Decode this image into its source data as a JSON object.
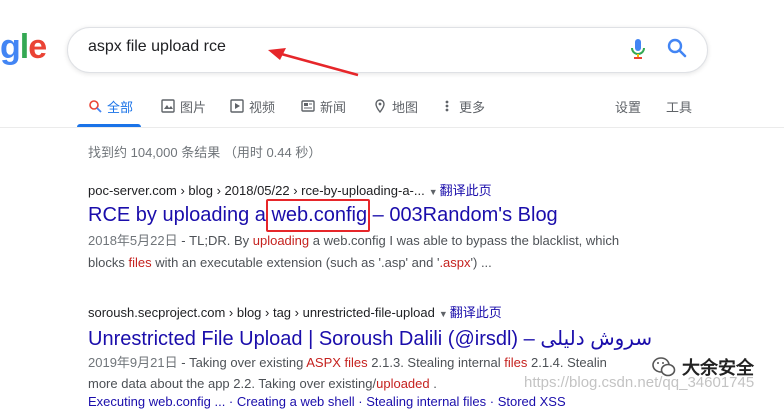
{
  "logo": {
    "g": "g",
    "l": "l",
    "e": "e"
  },
  "search": {
    "query": "aspx file upload rce"
  },
  "tabs": [
    {
      "label": "全部",
      "icon": "search-icon"
    },
    {
      "label": "图片",
      "icon": "image-icon"
    },
    {
      "label": "视频",
      "icon": "video-icon"
    },
    {
      "label": "新闻",
      "icon": "news-icon"
    },
    {
      "label": "地图",
      "icon": "map-pin-icon"
    },
    {
      "label": "更多",
      "icon": "more-icon"
    }
  ],
  "tools": {
    "settings": "设置",
    "tools": "工具"
  },
  "stats": "找到约 104,000 条结果 （用时 0.44 秒）",
  "results": [
    {
      "cite": "poc-server.com › blog › 2018/05/22 › rce-by-uploading-a-...",
      "translate": "翻译此页",
      "title_a": "RCE by uploading a ",
      "title_b": "web.config",
      "title_c": " – 003Random's Blog",
      "date": "2018年5月22日",
      "s1a": " - TL;DR. By ",
      "s1b": "uploading",
      "s1c": " a web.config I was able to bypass the blacklist, which",
      "s2a": "blocks ",
      "s2b": "files",
      "s2c": " with an executable extension (such as '.asp' and '",
      "s2d": ".aspx",
      "s2e": "') ..."
    },
    {
      "cite": "soroush.secproject.com › blog › tag › unrestricted-file-upload",
      "translate": "翻译此页",
      "title": "Unrestricted File Upload | Soroush Dalili (@irsdl) – سروش دلیلی",
      "date": "2019年9月21日",
      "s1a": " - Taking over existing ",
      "s1b": "ASPX files",
      "s1c": " 2.1.3. Stealing internal ",
      "s1d": "files",
      "s1e": " 2.1.4. Stealin",
      "s2a": "more data about the app 2.2. Taking over existing/",
      "s2b": "uploaded",
      "s2c": " .",
      "s3": "Executing web.config ... · Creating a web shell · Stealing internal files · Stored XSS"
    }
  ],
  "watermark": "https://blog.csdn.net/qq_34601745",
  "brand": "大余安全",
  "colors": {
    "accent": "#1a73e8",
    "link": "#1a0dab",
    "highlight": "#c5221f",
    "annotation": "#e6262a"
  }
}
